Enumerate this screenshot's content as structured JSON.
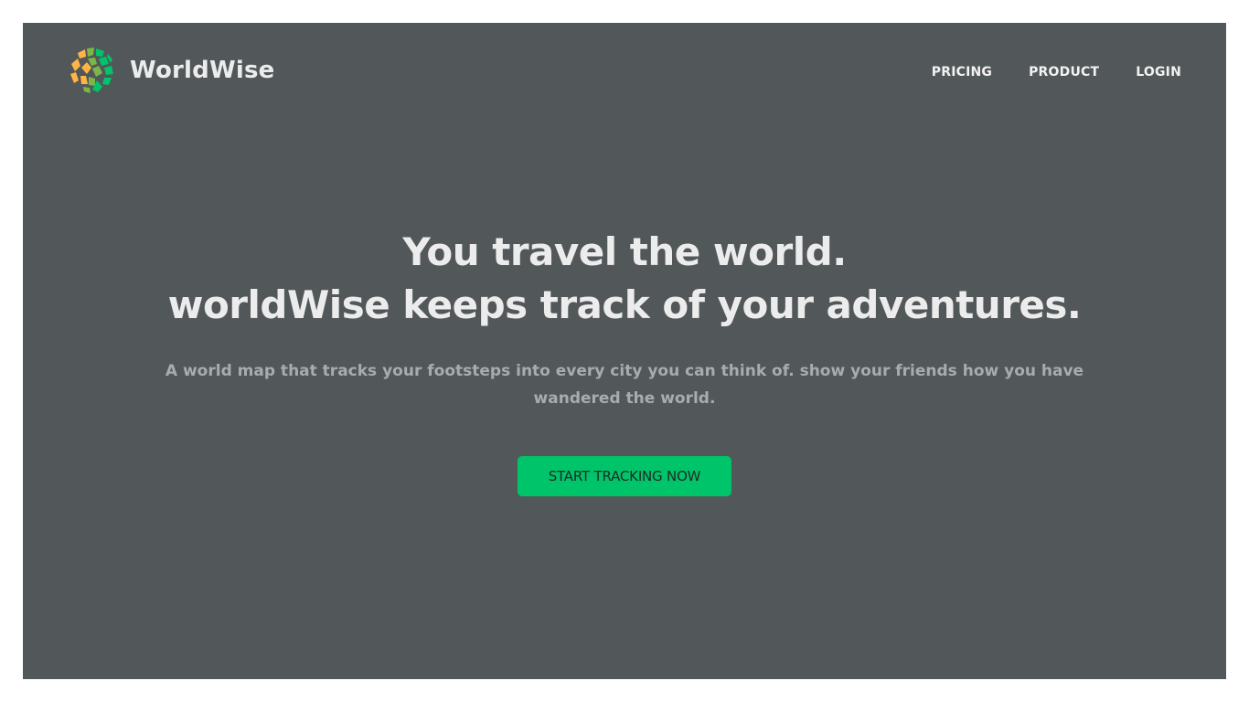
{
  "brand": {
    "name": "WorldWise",
    "logo_icon": "globe-logo-icon"
  },
  "nav": {
    "links": [
      {
        "label": "PRICING"
      },
      {
        "label": "PRODUCT"
      },
      {
        "label": "LOGIN"
      }
    ]
  },
  "hero": {
    "title_line1": "You travel the world.",
    "title_line2": "worldWise keeps track of your adventures.",
    "subtitle": "A world map that tracks your footsteps into every city you can think of. show your friends how you have wandered the world.",
    "cta_label": "START TRACKING NOW"
  },
  "colors": {
    "background": "#525759",
    "accent": "#00c46a",
    "logo_orange": "#ffb545",
    "logo_green": "#00c46a",
    "logo_lightgreen": "#7ab648"
  }
}
